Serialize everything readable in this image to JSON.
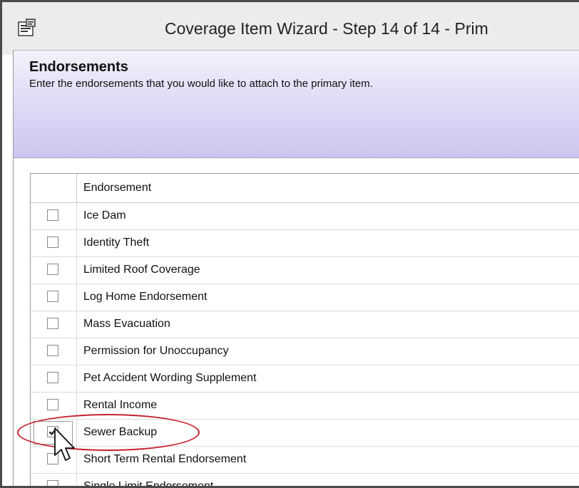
{
  "window": {
    "title": "Coverage Item Wizard - Step 14 of 14 - Prim",
    "icon": "properties-icon"
  },
  "banner": {
    "title": "Endorsements",
    "subtitle": "Enter the endorsements that you would like to attach to the primary item."
  },
  "grid": {
    "column_header": "Endorsement",
    "rows": [
      {
        "label": "Ice Dam",
        "checked": false
      },
      {
        "label": "Identity Theft",
        "checked": false
      },
      {
        "label": "Limited Roof Coverage",
        "checked": false
      },
      {
        "label": "Log Home Endorsement",
        "checked": false
      },
      {
        "label": "Mass Evacuation",
        "checked": false
      },
      {
        "label": "Permission for Unoccupancy",
        "checked": false
      },
      {
        "label": "Pet Accident Wording Supplement",
        "checked": false
      },
      {
        "label": "Rental Income",
        "checked": false
      },
      {
        "label": "Sewer Backup",
        "checked": true
      },
      {
        "label": "Short Term Rental Endorsement",
        "checked": false
      },
      {
        "label": "Single Limit Endorsement",
        "checked": false
      }
    ]
  },
  "colors": {
    "highlight": "#c8222c",
    "banner_gradient_end": "#cdc5f0"
  }
}
